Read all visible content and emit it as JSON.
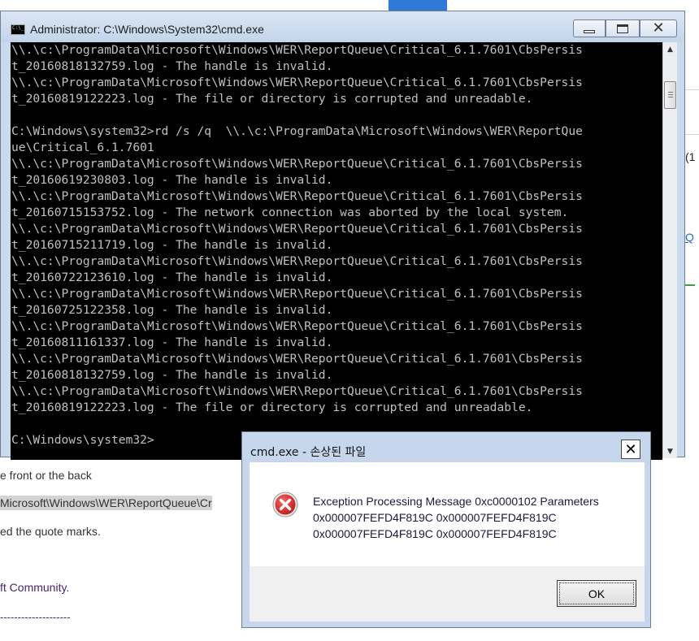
{
  "background_page": {
    "line1": "e front or the back",
    "path_snippet": "Microsoft\\Windows\\WER\\ReportQueue\\Cr",
    "line3": "ed the quote marks.",
    "community": "ft Community.",
    "dashes": "--------------------",
    "side_paren": "(1",
    "side_link": "Q"
  },
  "cmd_window": {
    "title": "Administrator: C:\\Windows\\System32\\cmd.exe",
    "icon_label": "C:\\_",
    "lines": [
      "\\\\.\\c:\\ProgramData\\Microsoft\\Windows\\WER\\ReportQueue\\Critical_6.1.7601\\CbsPersis",
      "t_20160818132759.log - The handle is invalid.",
      "\\\\.\\c:\\ProgramData\\Microsoft\\Windows\\WER\\ReportQueue\\Critical_6.1.7601\\CbsPersis",
      "t_20160819122223.log - The file or directory is corrupted and unreadable.",
      "",
      "C:\\Windows\\system32>rd /s /q  \\\\.\\c:\\ProgramData\\Microsoft\\Windows\\WER\\ReportQue",
      "ue\\Critical_6.1.7601",
      "\\\\.\\c:\\ProgramData\\Microsoft\\Windows\\WER\\ReportQueue\\Critical_6.1.7601\\CbsPersis",
      "t_20160619230803.log - The handle is invalid.",
      "\\\\.\\c:\\ProgramData\\Microsoft\\Windows\\WER\\ReportQueue\\Critical_6.1.7601\\CbsPersis",
      "t_20160715153752.log - The network connection was aborted by the local system.",
      "\\\\.\\c:\\ProgramData\\Microsoft\\Windows\\WER\\ReportQueue\\Critical_6.1.7601\\CbsPersis",
      "t_20160715211719.log - The handle is invalid.",
      "\\\\.\\c:\\ProgramData\\Microsoft\\Windows\\WER\\ReportQueue\\Critical_6.1.7601\\CbsPersis",
      "t_20160722123610.log - The handle is invalid.",
      "\\\\.\\c:\\ProgramData\\Microsoft\\Windows\\WER\\ReportQueue\\Critical_6.1.7601\\CbsPersis",
      "t_20160725122358.log - The handle is invalid.",
      "\\\\.\\c:\\ProgramData\\Microsoft\\Windows\\WER\\ReportQueue\\Critical_6.1.7601\\CbsPersis",
      "t_20160811161337.log - The handle is invalid.",
      "\\\\.\\c:\\ProgramData\\Microsoft\\Windows\\WER\\ReportQueue\\Critical_6.1.7601\\CbsPersis",
      "t_20160818132759.log - The handle is invalid.",
      "\\\\.\\c:\\ProgramData\\Microsoft\\Windows\\WER\\ReportQueue\\Critical_6.1.7601\\CbsPersis",
      "t_20160819122223.log - The file or directory is corrupted and unreadable.",
      "",
      "C:\\Windows\\system32>"
    ]
  },
  "error_dialog": {
    "title": "cmd.exe - 손상된 파일",
    "message_lines": [
      "Exception Processing Message 0xc0000102 Parameters",
      "0x000007FEFD4F819C 0x000007FEFD4F819C",
      "0x000007FEFD4F819C 0x000007FEFD4F819C"
    ],
    "ok_label": "OK",
    "icon": "error-icon"
  },
  "colors": {
    "console_bg": "#000000",
    "console_fg": "#c0c0c0",
    "window_frame": "#c9d9ee",
    "error_red": "#d42020"
  }
}
